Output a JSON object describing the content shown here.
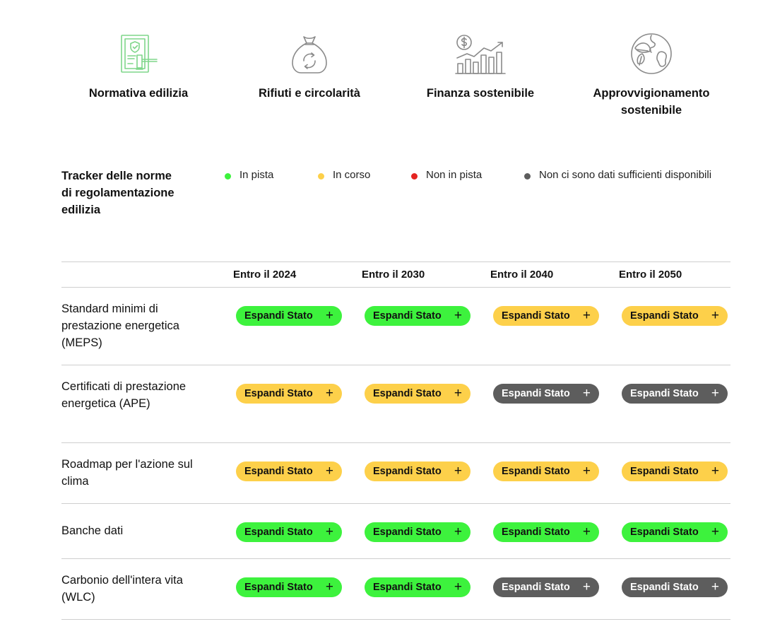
{
  "colors": {
    "in_pista": "#3df23d",
    "in_corso": "#fdd04a",
    "non_in_pista": "#e52421",
    "no_data": "#5d5d5d",
    "icon_active": "#7fd68a",
    "icon_inactive": "#8a8a8a"
  },
  "topics": [
    {
      "label": "Normativa edilizia",
      "icon": "regulation-gavel-icon"
    },
    {
      "label": "Rifiuti e circolarità",
      "icon": "waste-bag-recycle-icon"
    },
    {
      "label": "Finanza sostenibile",
      "icon": "finance-growth-chart-icon"
    },
    {
      "label": "Approvvigionamento sostenibile",
      "icon": "globe-leaf-icon"
    }
  ],
  "tracker": {
    "title": "Tracker delle norme di regolamentazione edilizia"
  },
  "legend": [
    {
      "label": "In pista",
      "status": "green"
    },
    {
      "label": "In corso",
      "status": "yellow"
    },
    {
      "label": "Non in pista",
      "status": "red"
    },
    {
      "label": "Non ci sono dati sufficienti disponibili",
      "status": "gray"
    }
  ],
  "table": {
    "columns": [
      "Entro il 2024",
      "Entro il 2030",
      "Entro il 2040",
      "Entro il 2050"
    ],
    "button_label": "Espandi Stato",
    "plus_symbol": "+",
    "rows": [
      {
        "label": "Standard minimi di prestazione energetica (MEPS)",
        "statuses": [
          "green",
          "green",
          "yellow",
          "yellow"
        ]
      },
      {
        "label": "Certificati di prestazione energetica (APE)",
        "statuses": [
          "yellow",
          "yellow",
          "gray",
          "gray"
        ]
      },
      {
        "label": "Roadmap per l'azione sul clima",
        "statuses": [
          "yellow",
          "yellow",
          "yellow",
          "yellow"
        ]
      },
      {
        "label": "Banche dati",
        "statuses": [
          "green",
          "green",
          "green",
          "green"
        ]
      },
      {
        "label": "Carbonio dell'intera vita (WLC)",
        "statuses": [
          "green",
          "green",
          "gray",
          "gray"
        ]
      }
    ]
  }
}
